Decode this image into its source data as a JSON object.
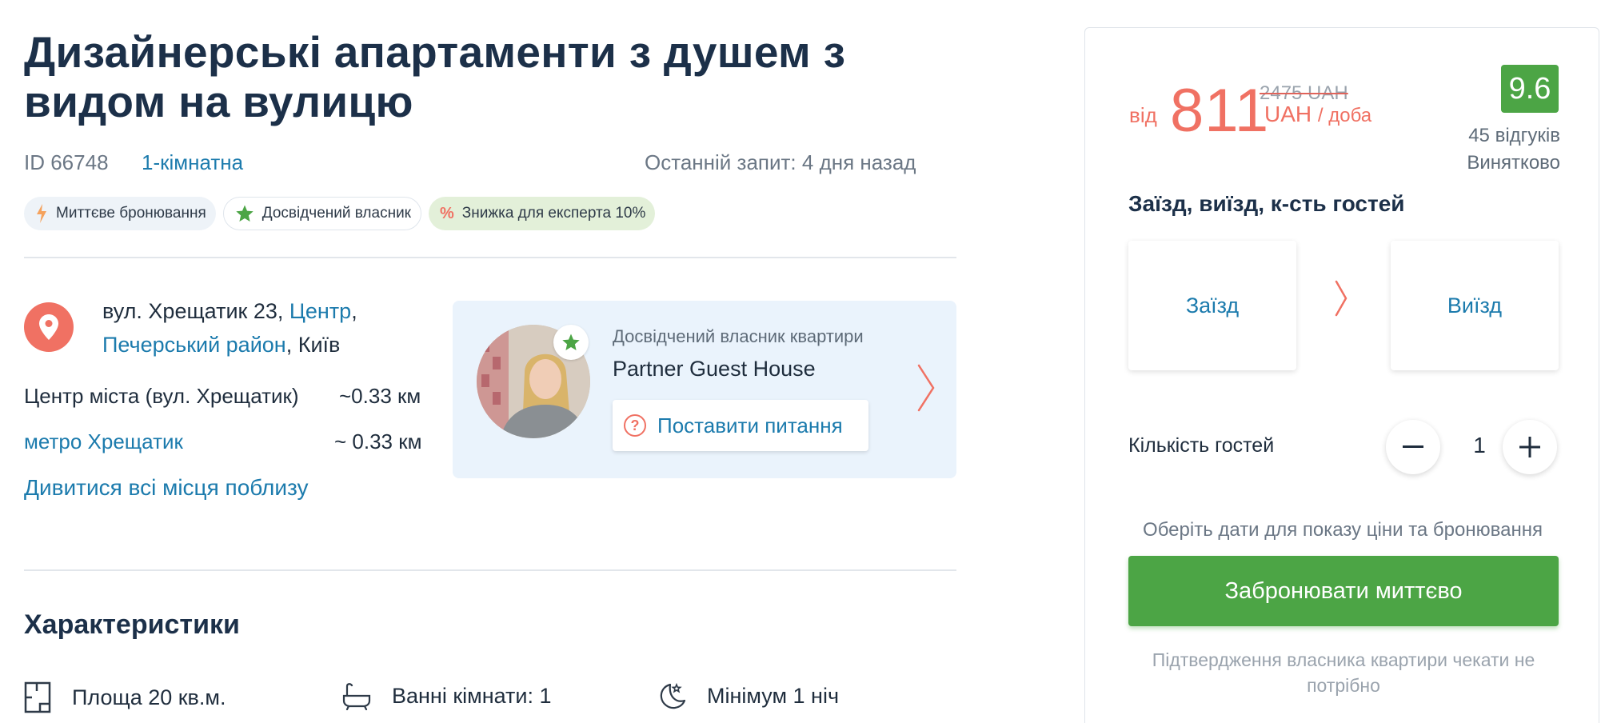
{
  "listing": {
    "title": "Дизайнерські апартаменти з душем з видом на вулицю",
    "id": "ID 66748",
    "rooms": "1-кімнатна",
    "last_request": "Останній запит: 4 дня назад"
  },
  "badges": [
    {
      "label": "Миттєве бронювання",
      "icon": "lightning-icon"
    },
    {
      "label": "Досвідчений власник",
      "icon": "star-icon"
    },
    {
      "label": "Знижка для експерта 10%",
      "icon": "percent-icon"
    }
  ],
  "address": {
    "street": "вул. Хрещатик 23, ",
    "district_link": "Центр",
    "sep": ",",
    "area_link": "Печерський район",
    "city": ", Київ"
  },
  "distances": [
    {
      "name": "Центр міста (вул. Хрещатик)",
      "value": "~0.33 км"
    },
    {
      "name": "метро Хрещатик",
      "value": "~ 0.33 км"
    }
  ],
  "nearby_link": "Дивитися всі місця поблизу",
  "host": {
    "role": "Досвідчений власник квартири",
    "name": "Partner Guest House",
    "ask_label": "Поставити питання",
    "ask_icon": "?"
  },
  "features": {
    "heading": "Характеристики",
    "items": [
      {
        "label": "Площа 20 кв.м.",
        "icon": "floorplan-icon"
      },
      {
        "label": "Ванні кімнати: 1",
        "icon": "bathtub-icon"
      },
      {
        "label": "Мінімум 1 ніч",
        "icon": "moon-icon"
      }
    ]
  },
  "booking": {
    "from_label": "від",
    "price": "811",
    "old_price": "2475 UAH",
    "currency": "UAH",
    "per_label": "/ доба",
    "score": "9.6",
    "reviews": "45 відгуків",
    "rating_word": "Винятково",
    "section_title": "Заїзд, виїзд, к-сть гостей",
    "checkin": "Заїзд",
    "checkout": "Виїзд",
    "guests_label": "Кількість гостей",
    "guests_value": "1",
    "hint": "Оберіть дати для показу ціни та бронювання",
    "book_label": "Забронювати миттєво",
    "confirm_note": "Підтвердження власника квартири чекати не потрібно"
  },
  "colors": {
    "accent_red": "#f07163",
    "link_blue": "#1c7bad",
    "green": "#4ca545",
    "heading": "#1c3049"
  }
}
